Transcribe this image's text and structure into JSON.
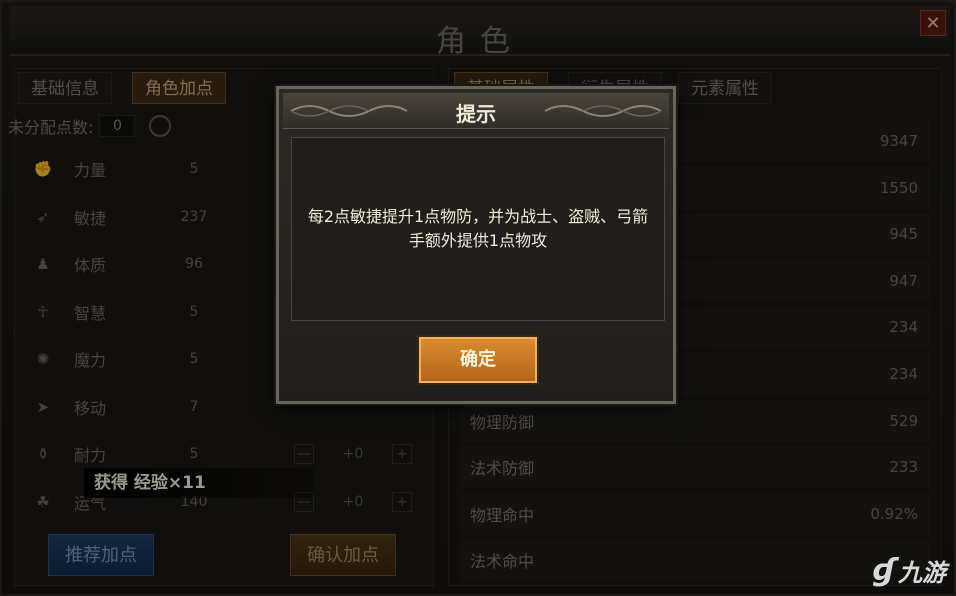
{
  "window": {
    "title": "角色",
    "close_glyph": "✕"
  },
  "left": {
    "tabs": [
      "基础信息",
      "角色加点"
    ],
    "unallocated_label": "未分配点数:",
    "unallocated_value": "0",
    "stats": [
      {
        "name": "力量",
        "value": "5",
        "icon": "fist-icon",
        "glyph": "✊"
      },
      {
        "name": "敏捷",
        "value": "237",
        "icon": "agility-icon",
        "glyph": "➶"
      },
      {
        "name": "体质",
        "value": "96",
        "icon": "body-icon",
        "glyph": "♟"
      },
      {
        "name": "智慧",
        "value": "5",
        "icon": "wisdom-icon",
        "glyph": "☥"
      },
      {
        "name": "魔力",
        "value": "5",
        "icon": "magic-icon",
        "glyph": "✺"
      },
      {
        "name": "移动",
        "value": "7",
        "icon": "move-icon",
        "glyph": "➤"
      },
      {
        "name": "耐力",
        "value": "5",
        "icon": "stamina-icon",
        "glyph": "⚱",
        "plus": "+0"
      },
      {
        "name": "运气",
        "value": "140",
        "icon": "luck-icon",
        "glyph": "☘",
        "plus": "+0"
      }
    ],
    "minus_glyph": "—",
    "plus_glyph": "+",
    "recommend_label": "推荐加点",
    "confirm_label": "确认加点"
  },
  "toast": {
    "text": "获得 经验×11"
  },
  "right": {
    "tabs": [
      "基础属性",
      "衍生属性",
      "元素属性"
    ],
    "attributes": [
      {
        "name": "",
        "value": "9347"
      },
      {
        "name": "",
        "value": "1550"
      },
      {
        "name": "",
        "value": "945"
      },
      {
        "name": "",
        "value": "947"
      },
      {
        "name": "",
        "value": "234"
      },
      {
        "name": "",
        "value": "234"
      },
      {
        "name": "物理防御",
        "value": "529"
      },
      {
        "name": "法术防御",
        "value": "233"
      },
      {
        "name": "物理命中",
        "value": "0.92%"
      },
      {
        "name": "法术命中",
        "value": ""
      }
    ]
  },
  "dialog": {
    "title": "提示",
    "message": "每2点敏捷提升1点物防，并为战士、盗贼、弓箭手额外提供1点物攻",
    "ok_label": "确定"
  },
  "watermark": {
    "text": "九游"
  }
}
